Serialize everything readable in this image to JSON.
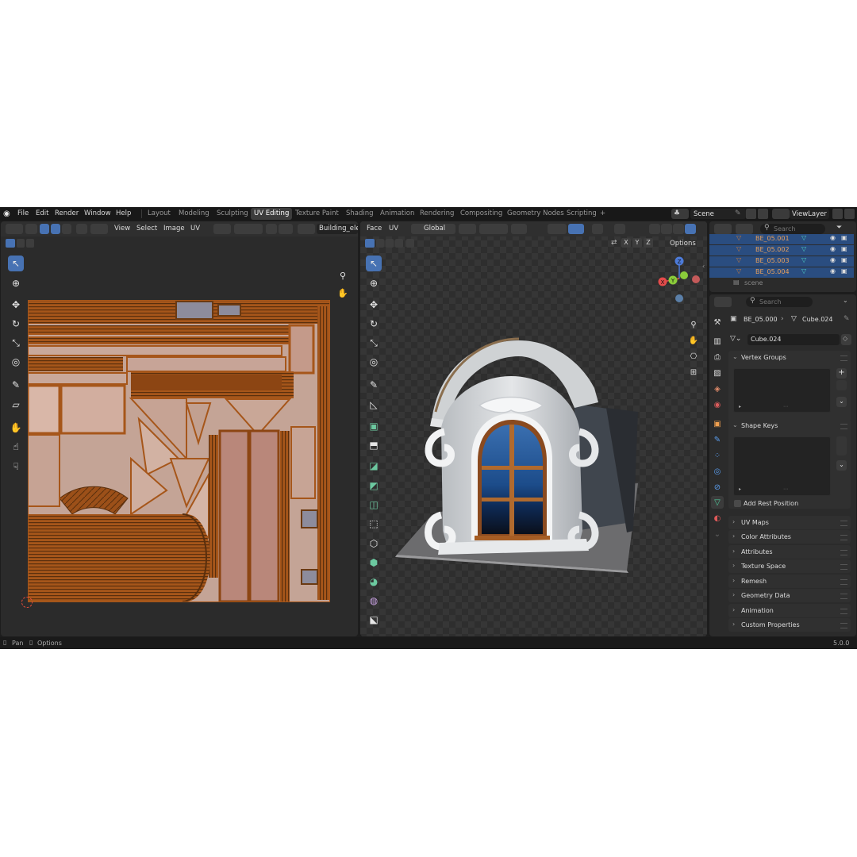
{
  "menubar": {
    "menus": [
      "File",
      "Edit",
      "Render",
      "Window",
      "Help"
    ],
    "workspaces": [
      "Layout",
      "Modeling",
      "Sculpting",
      "UV Editing",
      "Texture Paint",
      "Shading",
      "Animation",
      "Rendering",
      "Compositing",
      "Geometry Nodes",
      "Scripting"
    ],
    "active_workspace": "UV Editing",
    "add_tab": "+",
    "scene": "Scene",
    "view_layer": "ViewLayer"
  },
  "uv_editor": {
    "menus": [
      "View",
      "Select",
      "Image",
      "UV"
    ],
    "image_name": "Building_elem"
  },
  "viewport": {
    "menus": [
      "Face",
      "UV"
    ],
    "orientation": "Global",
    "axes": [
      "X",
      "Y",
      "Z"
    ],
    "options": "Options",
    "gizmo": {
      "z": "Z",
      "y": "Y",
      "x": "X"
    }
  },
  "outliner": {
    "search_placeholder": "Search",
    "items": [
      "BE_05.001",
      "BE_05.002",
      "BE_05.003",
      "BE_05.004"
    ],
    "collection": "scene"
  },
  "properties": {
    "search_placeholder": "Search",
    "breadcrumb_object": "BE_05.000",
    "breadcrumb_mesh": "Cube.024",
    "mesh_name": "Cube.024",
    "vertex_groups": "Vertex Groups",
    "shape_keys": "Shape Keys",
    "add_rest_position": "Add Rest Position",
    "collapsed_panels": [
      "UV Maps",
      "Color Attributes",
      "Attributes",
      "Texture Space",
      "Remesh",
      "Geometry Data",
      "Animation",
      "Custom Properties"
    ]
  },
  "statusbar": {
    "pan": "Pan",
    "options": "Options",
    "version": "5.0.0"
  },
  "colors": {
    "accent": "#4772b3",
    "uv_orange": "#b8651c",
    "ui_bg": "#2b2b2b"
  }
}
